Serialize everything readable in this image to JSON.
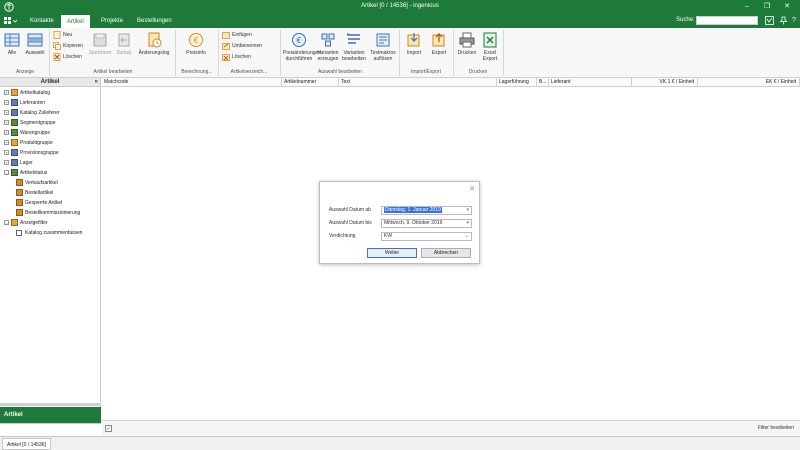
{
  "window": {
    "title": "Artikel [0 / 14536] - ingenious",
    "controls": {
      "help": "?",
      "minimize": "–",
      "restore": "❐",
      "close": "✕"
    }
  },
  "tabs": [
    {
      "label": "Kontakte",
      "active": false
    },
    {
      "label": "Artikel",
      "active": true
    },
    {
      "label": "Projekte",
      "active": false
    },
    {
      "label": "Bestellungen",
      "active": false
    }
  ],
  "search": {
    "label": "Suche:",
    "value": "",
    "placeholder": ""
  },
  "ribbon": {
    "groups": {
      "anzeige": "Anzeige",
      "artikel_bearbeiten": "Artikel bearbeiten",
      "berechnung": "Berechnung...",
      "artikelverzeichnis": "Artikelverzeich...",
      "auswahl_bearbeiten": "Auswahl bearbeiten",
      "import_export": "Import/Export",
      "drucken": "Drucken"
    },
    "buttons": {
      "alle": "Alle",
      "auswahl": "Auswahl",
      "neu": "Neu",
      "kopieren": "Kopieren",
      "loeschen": "Löschen",
      "speichern": "Speichern",
      "zurueck": "Zurück",
      "aenderungslog": "Änderungslog",
      "preisinfo": "Preisinfo",
      "einfuegen": "Einfügen",
      "umbenennen": "Umbenennen",
      "loeschen2": "Löschen",
      "preisaenderungen_1": "Preisänderungen",
      "preisaenderungen_2": "durchführen",
      "varianten_erzeugen_1": "Varianten",
      "varianten_erzeugen_2": "erzeugen",
      "varianten_bearbeiten_1": "Varianten",
      "varianten_bearbeiten_2": "bearbeiten",
      "textmakros_1": "Textmakros",
      "textmakros_2": "auflösen",
      "import": "Import",
      "export": "Export",
      "drucken": "Drucken",
      "excel_export_1": "Excel",
      "excel_export_2": "Export"
    }
  },
  "left_panel": {
    "header": "Artikel",
    "collapse": "«",
    "items": [
      {
        "label": "Artikelkatalog",
        "expander": "+",
        "color": "#e8a33a"
      },
      {
        "label": "Lieferanten",
        "expander": "+",
        "color": "#5a7fb5"
      },
      {
        "label": "Katalog Zulieferer",
        "expander": "+",
        "color": "#5a7fb5"
      },
      {
        "label": "Segmentgruppe",
        "expander": "+",
        "color": "#5b8a3a"
      },
      {
        "label": "Warengruppe",
        "expander": "+",
        "color": "#5b8a3a"
      },
      {
        "label": "Produktgruppe",
        "expander": "+",
        "color": "#e8a33a"
      },
      {
        "label": "Provisionsgruppe",
        "expander": "+",
        "color": "#5a7fb5"
      },
      {
        "label": "Lager",
        "expander": "+",
        "color": "#5a7fb5"
      },
      {
        "label": "Artikelstatus",
        "expander": "–",
        "color": "#5b8a3a"
      },
      {
        "label": "Verkaufsartikel",
        "expander": "",
        "color": "#d9892a"
      },
      {
        "label": "Bestellartikel",
        "expander": "",
        "color": "#d9892a"
      },
      {
        "label": "Gesperrte Artikel",
        "expander": "",
        "color": "#d9892a"
      },
      {
        "label": "Bestellkommissionierung",
        "expander": "",
        "color": "#d9892a"
      },
      {
        "label": "Anzeigefilter",
        "expander": "–",
        "color": "#e8a33a"
      },
      {
        "label": "Katalog zusammenfassen",
        "expander": "",
        "color": ""
      }
    ],
    "footer": "Artikel"
  },
  "grid": {
    "columns": [
      {
        "label": "Matchcode"
      },
      {
        "label": "Artikelnummer"
      },
      {
        "label": "Text"
      },
      {
        "label": "Lagerführung"
      },
      {
        "label": "B..."
      },
      {
        "label": "Lieferant"
      },
      {
        "label": "VK 1 € / Einheit"
      },
      {
        "label": "EK € / Einheit"
      }
    ],
    "filter_button": "Filter bearbeiten"
  },
  "status_bar": {
    "tab": "Artikel [0 / 14536]"
  },
  "dialog": {
    "close": "✕",
    "fields": [
      {
        "label": "Auswahl Datum ab",
        "value": "Dienstag, 1. Januar 2019",
        "selected": true
      },
      {
        "label": "Auswahl Datum bis",
        "value": "Mittwoch, 9. Oktober 2019",
        "selected": false
      },
      {
        "label": "Verdichtung",
        "value": "KW",
        "selected": false
      }
    ],
    "ok_button": "Weiter",
    "cancel_button": "Abbrechen"
  },
  "colors": {
    "brand": "#1e7a3a",
    "selection": "#3874d8"
  }
}
